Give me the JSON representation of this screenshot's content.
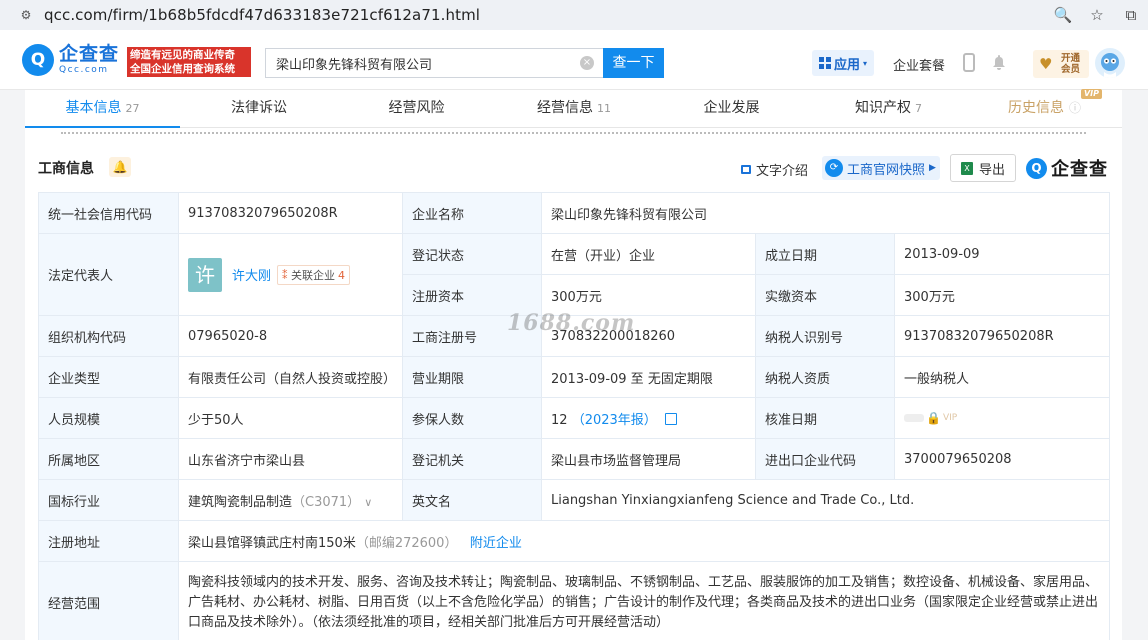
{
  "browser": {
    "url": "qcc.com/firm/1b68b5fdcdf47d633183e721cf612a71.html"
  },
  "header": {
    "logo_cn": "企查查",
    "logo_en": "Qcc.com",
    "slogan_line1": "缔造有远见的商业传奇",
    "slogan_line2": "全国企业信用查询系统",
    "search_value": "梁山印象先锋科贸有限公司",
    "search_button": "查一下",
    "apps_label": "应用",
    "suite_label": "企业套餐",
    "vip_line1": "开通",
    "vip_line2": "会员"
  },
  "tabs": [
    {
      "label": "基本信息",
      "count": "27"
    },
    {
      "label": "法律诉讼",
      "count": ""
    },
    {
      "label": "经营风险",
      "count": ""
    },
    {
      "label": "经营信息",
      "count": "11"
    },
    {
      "label": "企业发展",
      "count": ""
    },
    {
      "label": "知识产权",
      "count": "7"
    },
    {
      "label": "历史信息",
      "count": "",
      "badge": "VIP"
    }
  ],
  "section": {
    "title": "工商信息",
    "text_intro": "文字介绍",
    "snapshot": "工商官网快照",
    "export": "导出",
    "brand": "企查查"
  },
  "info": {
    "credit_code_label": "统一社会信用代码",
    "credit_code": "91370832079650208R",
    "company_name_label": "企业名称",
    "company_name": "梁山印象先锋科贸有限公司",
    "legal_rep_label": "法定代表人",
    "legal_rep_avatar": "许",
    "legal_rep_name": "许大刚",
    "related_label": "关联企业",
    "related_count": "4",
    "reg_status_label": "登记状态",
    "reg_status": "在营（开业）企业",
    "established_label": "成立日期",
    "established": "2013-09-09",
    "reg_capital_label": "注册资本",
    "reg_capital": "300万元",
    "paid_capital_label": "实缴资本",
    "paid_capital": "300万元",
    "org_code_label": "组织机构代码",
    "org_code": "07965020-8",
    "reg_no_label": "工商注册号",
    "reg_no": "370832200018260",
    "taxpayer_id_label": "纳税人识别号",
    "taxpayer_id": "91370832079650208R",
    "type_label": "企业类型",
    "type": "有限责任公司（自然人投资或控股）",
    "term_label": "营业期限",
    "term": "2013-09-09 至 无固定期限",
    "taxpayer_qual_label": "纳税人资质",
    "taxpayer_qual": "一般纳税人",
    "staff_label": "人员规模",
    "staff": "少于50人",
    "insured_label": "参保人数",
    "insured": "12",
    "insured_year": "（2023年报）",
    "approved_label": "核准日期",
    "approved_lock": "VIP",
    "region_label": "所属地区",
    "region": "山东省济宁市梁山县",
    "authority_label": "登记机关",
    "authority": "梁山县市场监督管理局",
    "ie_code_label": "进出口企业代码",
    "ie_code": "3700079650208",
    "industry_label": "国标行业",
    "industry": "建筑陶瓷制品制造",
    "industry_code": "（C3071）",
    "english_label": "英文名",
    "english": "Liangshan Yinxiangxianfeng Science and Trade Co., Ltd.",
    "address_label": "注册地址",
    "address": "梁山县馆驿镇武庄村南150米",
    "postcode": "（邮编272600）",
    "nearby": "附近企业",
    "scope_label": "经营范围",
    "scope": "陶瓷科技领域内的技术开发、服务、咨询及技术转让；陶瓷制品、玻璃制品、不锈钢制品、工艺品、服装服饰的加工及销售；数控设备、机械设备、家居用品、广告耗材、办公耗材、树脂、日用百货（以上不含危险化学品）的销售；广告设计的制作及代理；各类商品及技术的进出口业务（国家限定企业经营或禁止进出口商品及技术除外）。（依法须经批准的项目，经相关部门批准后方可开展经营活动）"
  },
  "watermark": "1688.com"
}
